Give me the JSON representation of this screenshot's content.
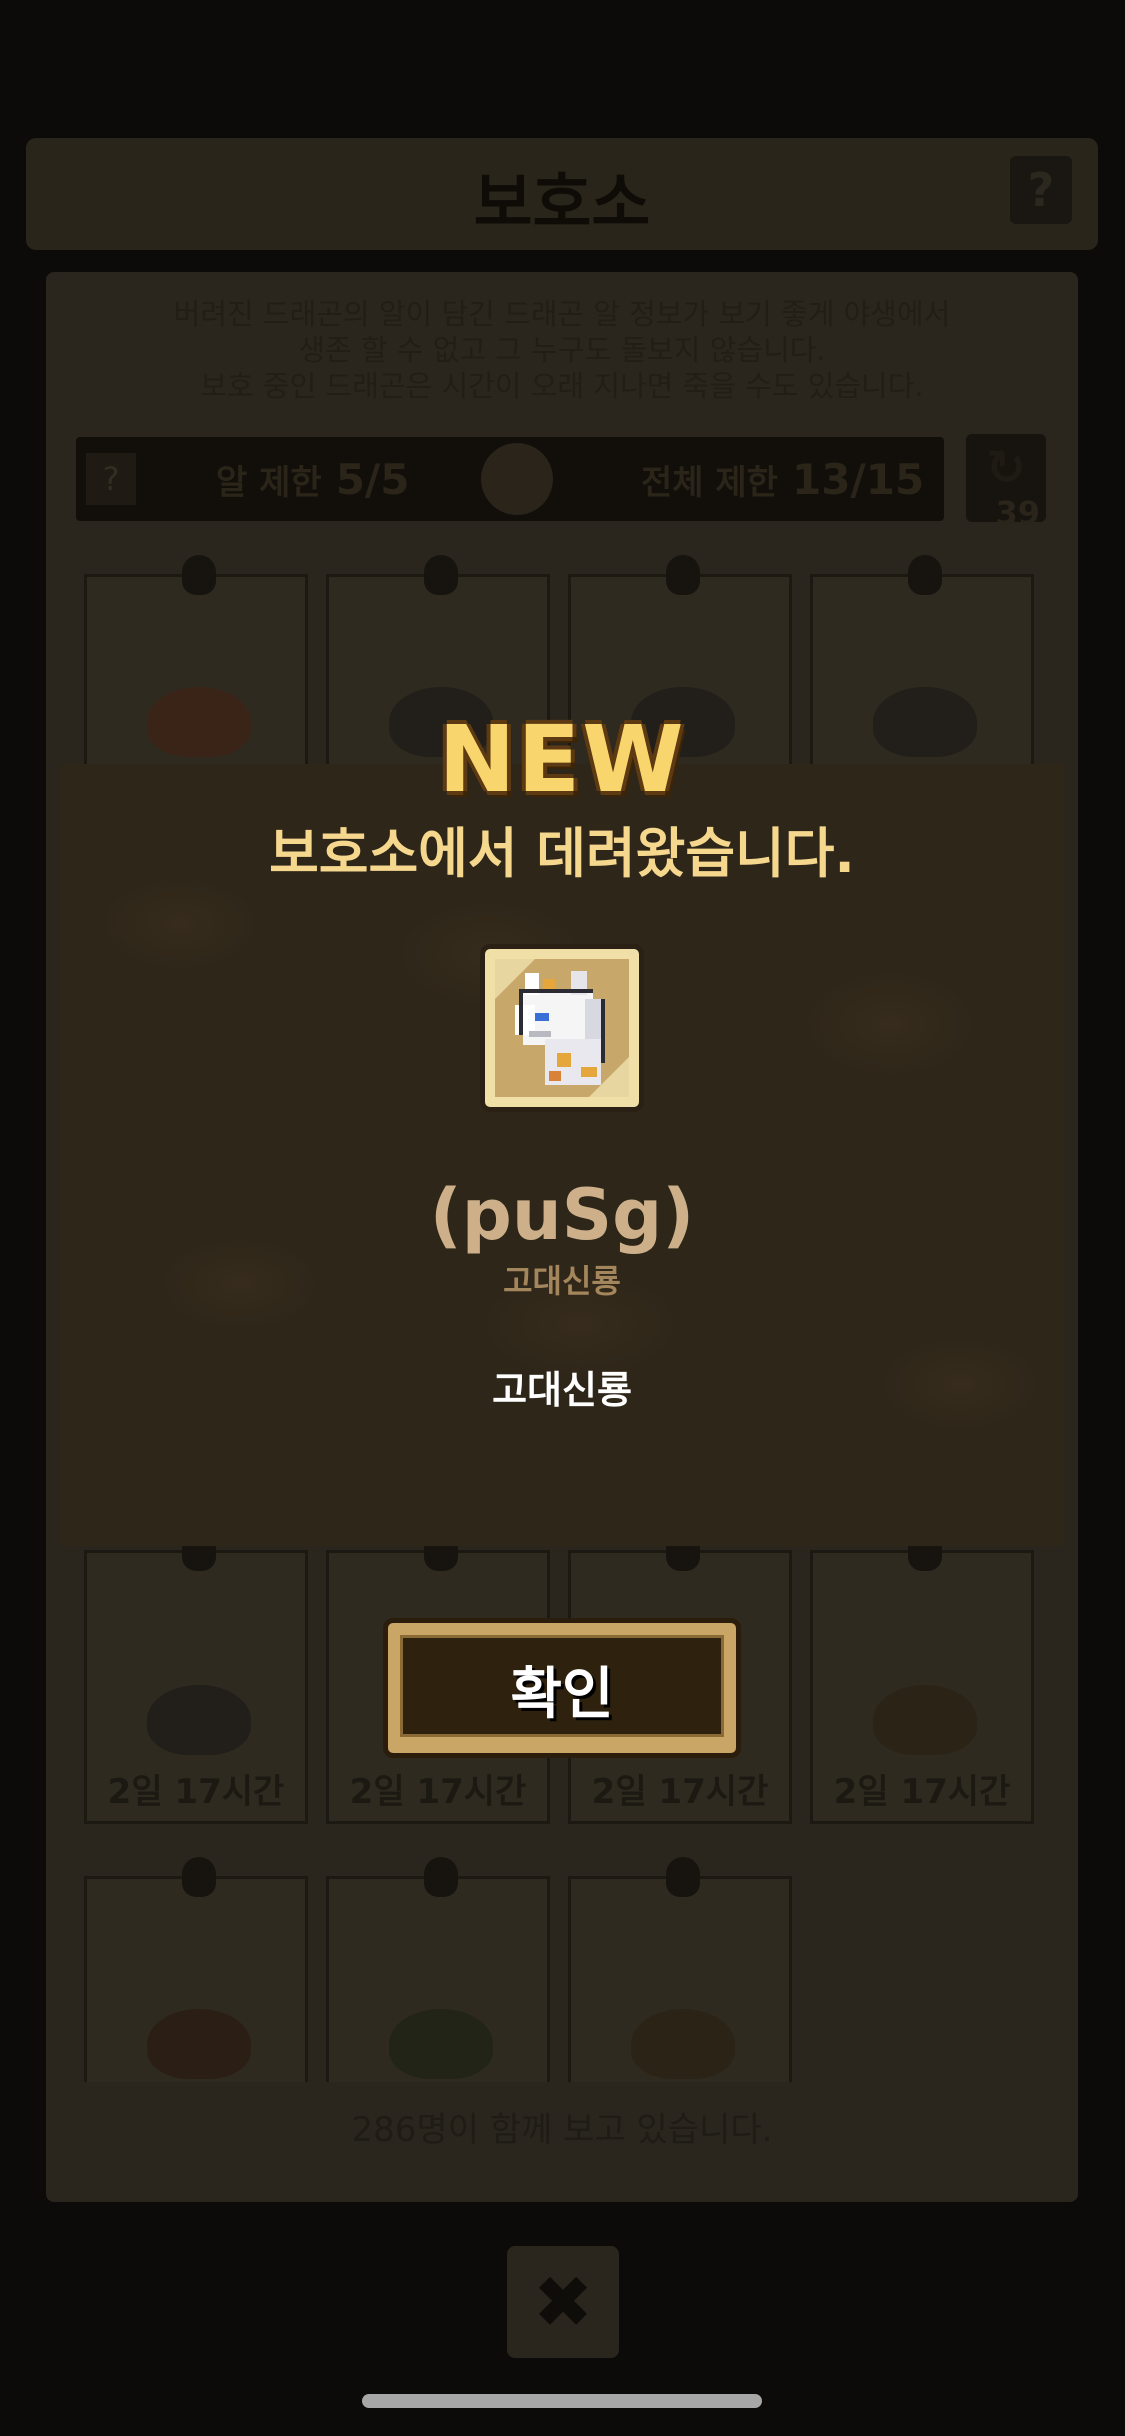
{
  "background": {
    "header": {
      "title": "보호소",
      "help_icon": "?"
    },
    "description": [
      "버려진 드래곤의 알이 담긴 드래곤 알 정보가 보기 좋게 야생에서",
      "생존 할 수 없고 그 누구도 돌보지 않습니다.",
      "보호 중인 드래곤은 시간이 오래 지나면 죽을 수도 있습니다."
    ],
    "limits": {
      "help_icon": "?",
      "egg_label": "알 제한",
      "egg_value": "5/5",
      "total_label": "전체 제한",
      "total_value": "13/15"
    },
    "refresh": {
      "icon": "↻",
      "count": "39"
    },
    "egg_times": [
      "2일 17시간",
      "2일 17시간",
      "2일 17시간",
      "2일 17시간"
    ],
    "footer": "286명이 함께 보고 있습니다.",
    "close_icon": "✖"
  },
  "modal": {
    "badge": "NEW",
    "message": "보호소에서 데려왔습니다.",
    "dragon": {
      "name": "(puSg)",
      "type_small": "고대신룡",
      "type": "고대신룡",
      "icon": "dragon-portrait"
    },
    "confirm_label": "확인"
  },
  "colors": {
    "accent": "#f9d56d",
    "modal_bg": "#2e2619",
    "button_frame": "#c9a566"
  }
}
